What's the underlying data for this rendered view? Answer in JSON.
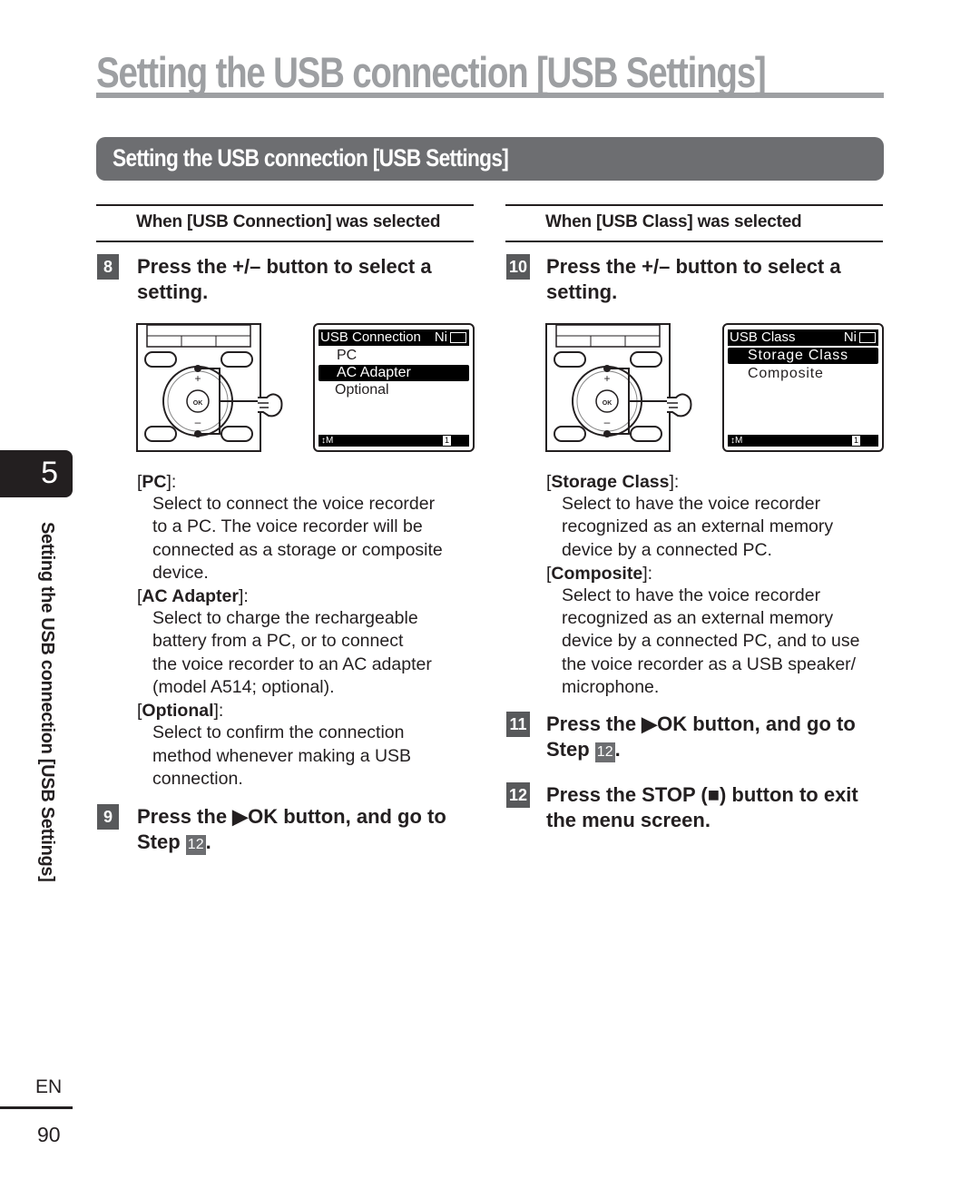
{
  "page": {
    "title": "Setting the USB connection [USB Settings]",
    "section_title": "Setting the USB connection [USB Settings]",
    "chapter_number": "5",
    "side_title": "Setting the USB connection [USB Settings]",
    "language": "EN",
    "page_number": "90"
  },
  "left": {
    "condition": {
      "prefix": "When [",
      "bold": "USB Connection",
      "suffix": "] was selected"
    },
    "step8": {
      "number": "8",
      "text": "Press the +/– button to select a setting."
    },
    "lcd": {
      "header": "USB Connection",
      "indicator": "Ni",
      "items": [
        {
          "label": "PC",
          "selected": false
        },
        {
          "label": "AC Adapter",
          "selected": true
        },
        {
          "label": "Optional",
          "selected": false
        }
      ],
      "footer_left": "↕M",
      "footer_right": "1"
    },
    "options": [
      {
        "name": "PC",
        "desc": [
          "Select to connect the voice recorder",
          "to a PC. The voice recorder will be",
          "connected as a storage or composite",
          "device."
        ]
      },
      {
        "name": "AC Adapter",
        "desc": [
          "Select to charge the rechargeable",
          "battery from a PC, or to connect",
          "the voice recorder to an AC adapter",
          "(model A514; optional)."
        ]
      },
      {
        "name": "Optional",
        "desc": [
          "Select to confirm the connection",
          "method whenever making a USB",
          "connection."
        ]
      }
    ],
    "step9": {
      "number": "9",
      "line1": "Press the ▶OK button, and go to",
      "line2_prefix": "Step ",
      "ref": "12",
      "line2_suffix": "."
    }
  },
  "right": {
    "condition": {
      "prefix": "When [",
      "bold": "USB Class",
      "suffix": "] was selected"
    },
    "step10": {
      "number": "10",
      "text": "Press the +/– button to select a setting."
    },
    "lcd": {
      "header": "USB Class",
      "indicator": "Ni",
      "items": [
        {
          "label": "Storage Class",
          "selected": true
        },
        {
          "label": "Composite",
          "selected": false
        }
      ],
      "footer_left": "↕M",
      "footer_right": "1"
    },
    "options": [
      {
        "name": "Storage Class",
        "desc": [
          "Select to have the voice recorder",
          "recognized as an external memory",
          "device by a connected PC."
        ]
      },
      {
        "name": "Composite",
        "desc": [
          "Select to have the voice recorder",
          "recognized as an external memory",
          "device by a connected PC, and to use",
          "the voice recorder as a USB speaker/",
          "microphone."
        ]
      }
    ],
    "step11": {
      "number": "11",
      "line1": "Press the ▶OK button, and go to",
      "line2_prefix": "Step ",
      "ref": "12",
      "line2_suffix": "."
    },
    "step12": {
      "number": "12",
      "line1": "Press the STOP (■) button to exit",
      "line2": "the menu screen."
    }
  },
  "device_labels": {
    "plus": "+",
    "minus": "–",
    "ok": "OK"
  }
}
